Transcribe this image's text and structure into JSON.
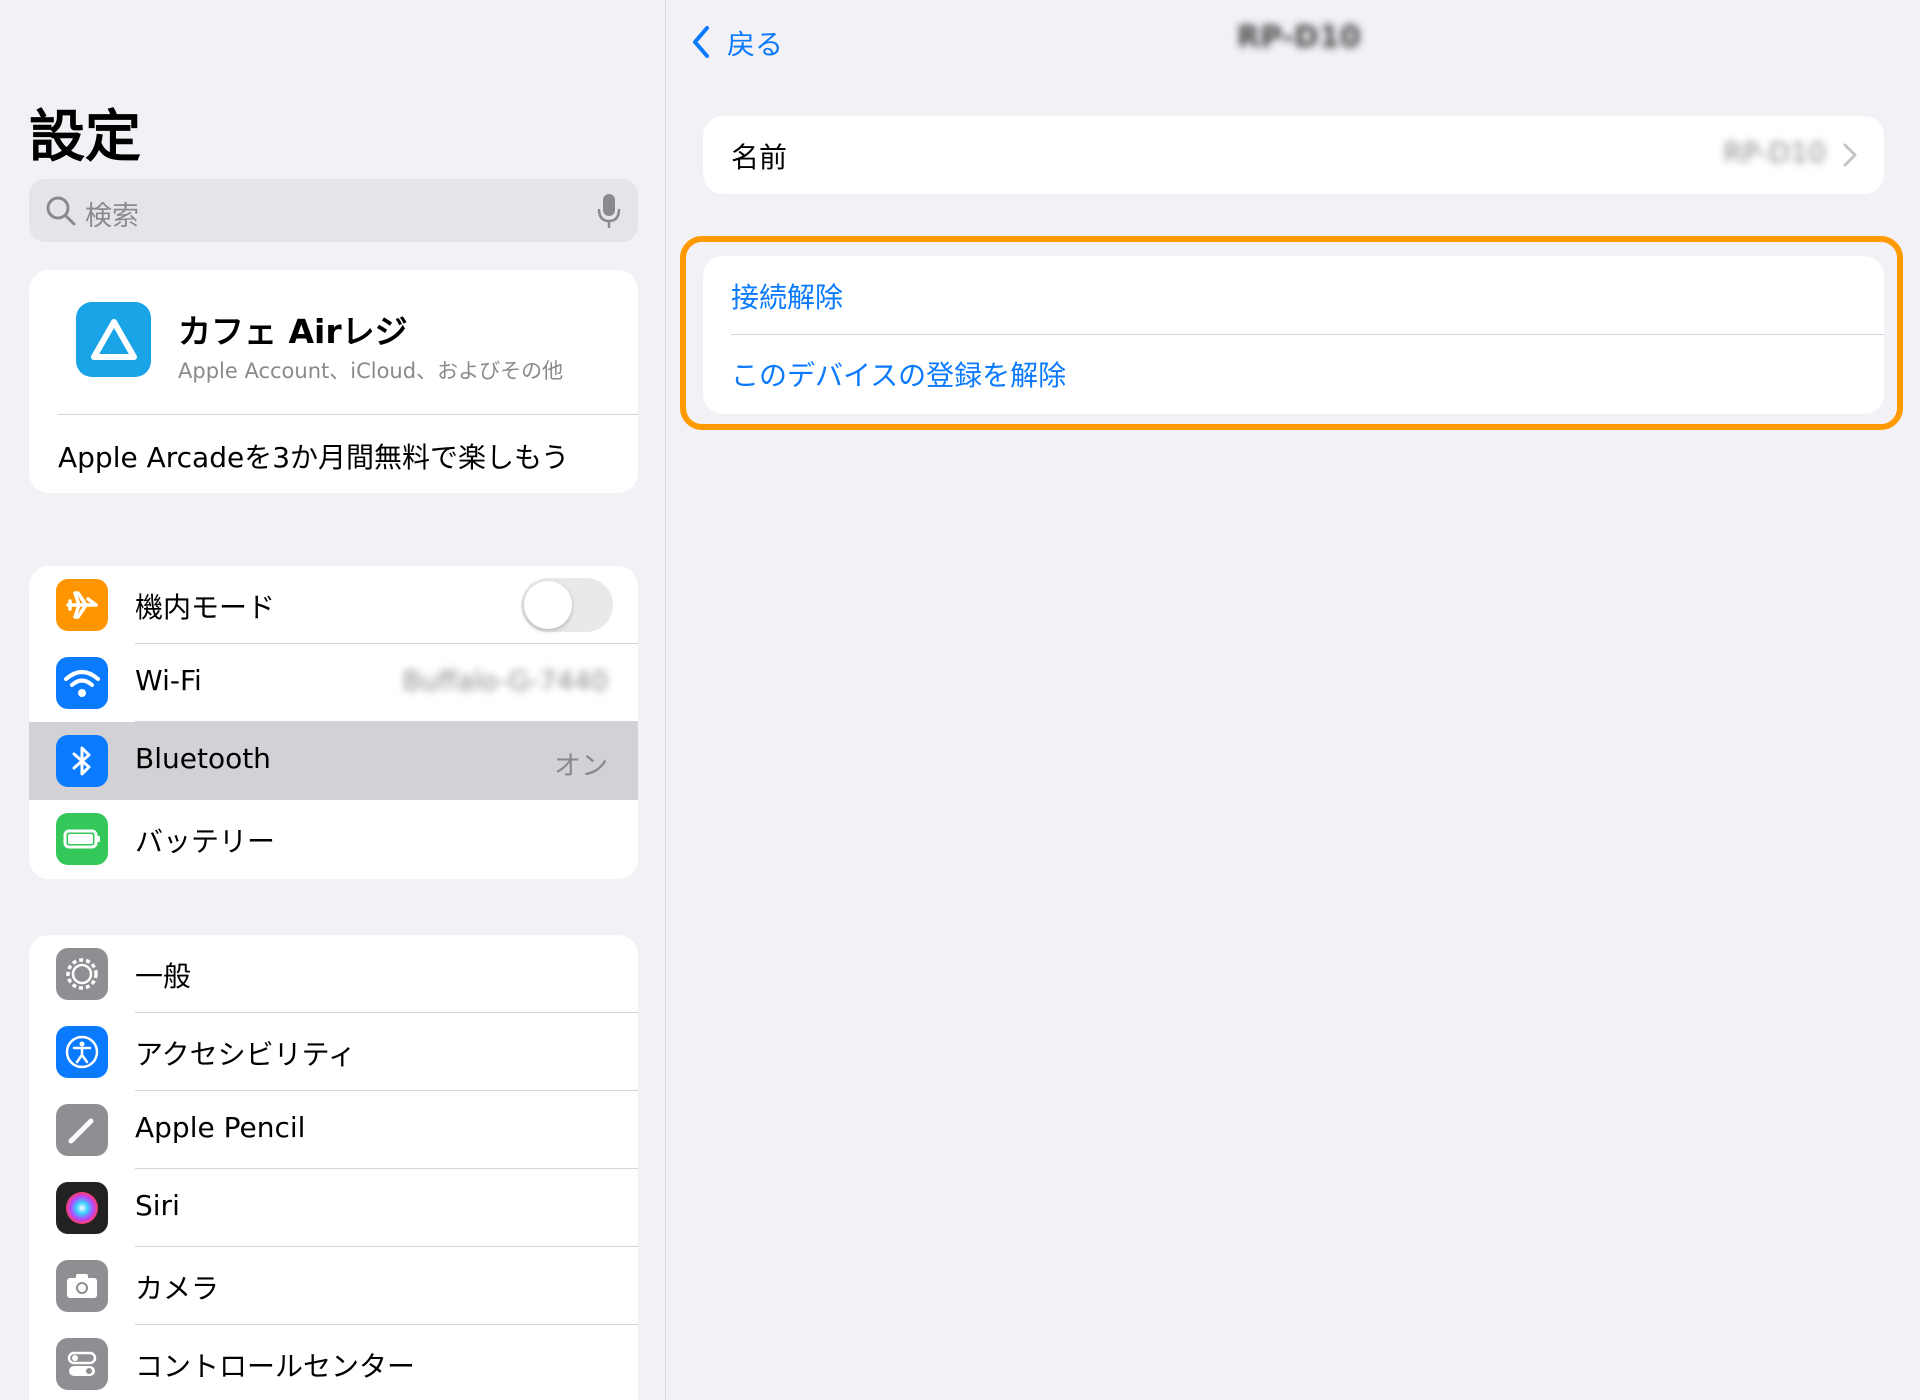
{
  "sidebar": {
    "title": "設定",
    "search": {
      "placeholder": "検索"
    },
    "account": {
      "name": "カフェ Airレジ",
      "subtitle": "Apple Account、iCloud、およびその他",
      "promo": "Apple Arcadeを3か月間無料で楽しもう"
    },
    "group1": [
      {
        "label": "機内モード",
        "icon": "airplane-icon",
        "color": "#ff9500",
        "toggle": false
      },
      {
        "label": "Wi-Fi",
        "icon": "wifi-icon",
        "color": "#0a7aff",
        "value": "Buffalo-G-7440"
      },
      {
        "label": "Bluetooth",
        "icon": "bluetooth-icon",
        "color": "#0a7aff",
        "value": "オン",
        "selected": true
      },
      {
        "label": "バッテリー",
        "icon": "battery-icon",
        "color": "#34c759"
      }
    ],
    "group2": [
      {
        "label": "一般",
        "icon": "gear-icon",
        "color": "#8e8e93"
      },
      {
        "label": "アクセシビリティ",
        "icon": "accessibility-icon",
        "color": "#0a7aff"
      },
      {
        "label": "Apple Pencil",
        "icon": "pencil-icon",
        "color": "#8e8e93"
      },
      {
        "label": "Siri",
        "icon": "siri-icon",
        "color": "#222222"
      },
      {
        "label": "カメラ",
        "icon": "camera-icon",
        "color": "#8e8e93"
      },
      {
        "label": "コントロールセンター",
        "icon": "control-center-icon",
        "color": "#8e8e93"
      }
    ]
  },
  "detail": {
    "back_label": "戻る",
    "title": "RP-D10",
    "name_label": "名前",
    "name_value": "RP-D10",
    "actions": {
      "disconnect": "接続解除",
      "forget": "このデバイスの登録を解除"
    }
  },
  "colors": {
    "accent": "#0a7aff",
    "highlight": "#ff9a00"
  }
}
